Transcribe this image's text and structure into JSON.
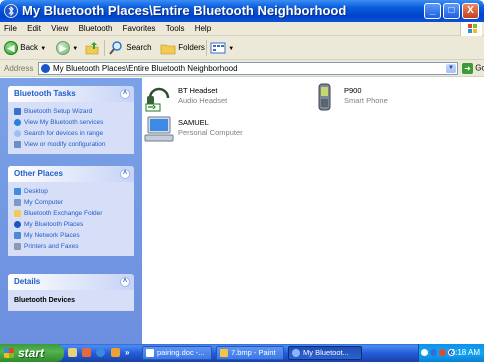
{
  "window": {
    "title": "My Bluetooth Places\\Entire Bluetooth Neighborhood",
    "controls": [
      "_",
      "□",
      "X"
    ]
  },
  "menu": [
    "File",
    "Edit",
    "View",
    "Bluetooth",
    "Favorites",
    "Tools",
    "Help"
  ],
  "toolbar": {
    "back_label": "Back",
    "search_label": "Search",
    "folders_label": "Folders"
  },
  "address": {
    "label": "Address",
    "value": "My Bluetooth Places\\Entire Bluetooth Neighborhood",
    "go_label": "Go"
  },
  "sidebar": {
    "tasks": {
      "title": "Bluetooth Tasks",
      "items": [
        "Bluetooth Setup Wizard",
        "View My Bluetooth services",
        "Search for devices in range",
        "View or modify configuration"
      ]
    },
    "other_places": {
      "title": "Other Places",
      "items": [
        "Desktop",
        "My Computer",
        "Bluetooth Exchange Folder",
        "My Bluetooth Places",
        "My Network Places",
        "Printers and Faxes"
      ]
    },
    "details": {
      "title": "Details",
      "text": "Bluetooth Devices"
    }
  },
  "devices": [
    {
      "name": "BT Headset",
      "type": "Audio Headset",
      "icon": "headset-icon"
    },
    {
      "name": "P900",
      "type": "Smart Phone",
      "icon": "phone-icon"
    },
    {
      "name": "SAMUEL",
      "type": "Personal Computer",
      "icon": "computer-icon"
    }
  ],
  "taskbar": {
    "start_label": "start",
    "quick_more": "»",
    "tasks": [
      "pairing.doc -...",
      "7.bmp - Paint",
      "My Bluetoot..."
    ],
    "clock": "4:18 AM"
  },
  "colors": {
    "titlebar": "#0a5bdc",
    "sidebar_bg": "#7ba2e7",
    "panel_link": "#215dc6",
    "start_green": "#3c9a3c"
  }
}
